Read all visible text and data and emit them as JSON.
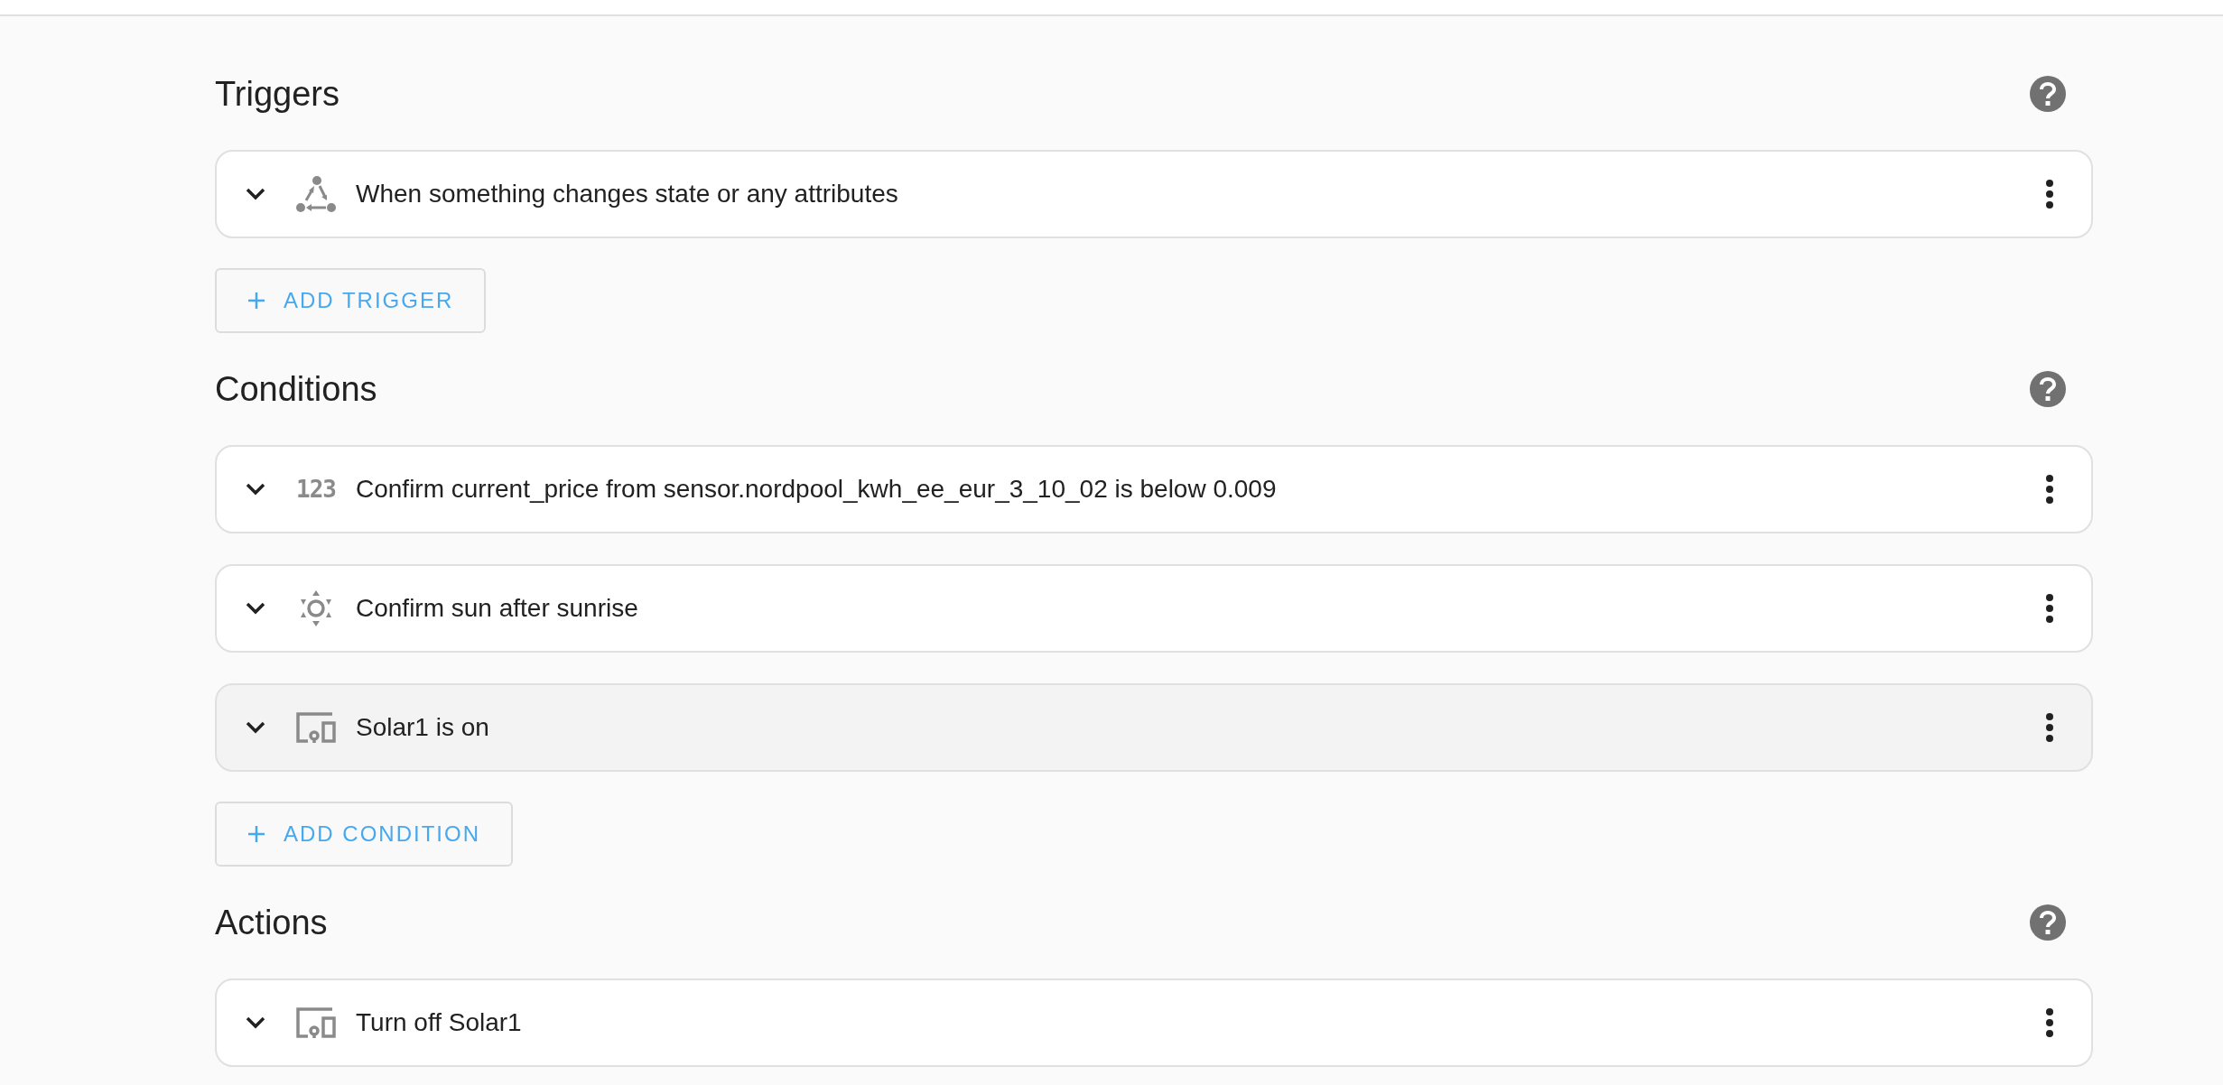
{
  "sections": [
    {
      "title": "Triggers",
      "rows": [
        {
          "kind": "state",
          "label": "When something changes state or any attributes",
          "highlighted": false
        }
      ],
      "add_button": "ADD TRIGGER"
    },
    {
      "title": "Conditions",
      "rows": [
        {
          "kind": "numeric",
          "icon_text": "123",
          "label": "Confirm current_price from sensor.nordpool_kwh_ee_eur_3_10_02 is below 0.009",
          "highlighted": false
        },
        {
          "kind": "sun",
          "label": "Confirm sun after sunrise",
          "highlighted": false
        },
        {
          "kind": "device",
          "label": "Solar1 is on",
          "highlighted": true
        }
      ],
      "add_button": "ADD CONDITION"
    },
    {
      "title": "Actions",
      "rows": [
        {
          "kind": "device",
          "label": "Turn off Solar1",
          "highlighted": false
        }
      ]
    }
  ]
}
